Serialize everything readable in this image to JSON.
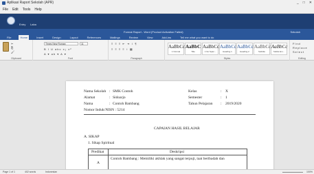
{
  "app": {
    "window_title": "Aplikasi Raport Sekolah (APR)",
    "controls": [
      "_",
      "□",
      "✕"
    ]
  },
  "menu": [
    "File",
    "Edit",
    "Tools",
    "Help"
  ],
  "task": {
    "labels": [
      "Entry",
      "Laba"
    ]
  },
  "ribbon": {
    "doc_title": "Format Raport - Word (Product Activation Failed)",
    "user": "Sekolah",
    "tabs": [
      "File",
      "Home",
      "Insert",
      "Design",
      "Layout",
      "References",
      "Mailings",
      "Review",
      "View",
      "Add-ins",
      "Tell me what you want to do"
    ],
    "active_tab": "Home",
    "groups": {
      "clipboard": "Clipboard",
      "font": "Font",
      "paragraph": "Paragraph",
      "styles": "Styles",
      "editing": "Editing"
    },
    "font_name": "Times New Roman",
    "font_size": "11",
    "styles": [
      {
        "sample": "AaBbCcI",
        "name": "1 Normal"
      },
      {
        "sample": "AaBbC",
        "name": "Title"
      },
      {
        "sample": "AaBbCcI",
        "name": "1 No Spac..."
      },
      {
        "sample": "AaBbCc",
        "name": "Heading 1"
      },
      {
        "sample": "AaBbCc",
        "name": "Heading 2"
      },
      {
        "sample": "AaBbCc",
        "name": "Subtitle"
      },
      {
        "sample": "AaBbCc",
        "name": "Subtle Em..."
      }
    ],
    "editing": [
      "Find",
      "Replace",
      "Select"
    ]
  },
  "document": {
    "nama_sekolah_label": "Nama Sekolah",
    "nama_sekolah_value": "SMK Contoh",
    "alamat_label": "Alamat",
    "alamat_value": "Sidoarjo",
    "nama_label": "Nama",
    "nama_value": "Contoh Bambang",
    "nomor_label": "Nomor Induk/NISN : 5214",
    "kelas_label": "Kelas",
    "kelas_value": "X",
    "semester_label": "Semester",
    "semester_value": "1",
    "tahun_label": "Tahun Pelajaran",
    "tahun_value": "2019/2020",
    "sep": ":",
    "heading": "CAPAIAN HASIL BELAJAR",
    "section_a": "A. SIKAP",
    "subsection_1": "1.  Sikap Spiritual",
    "table_col1": "Predikat",
    "table_col2": "Deskripsi",
    "table_row1_predikat": "A",
    "table_row1_desc": "Contoh Bambang : Memiliki akhlak yang sangat terpuji, taat beribadah dan"
  },
  "status": {
    "page": "Page 1 of 1",
    "words": "402 words",
    "lang": "Indonesian",
    "zoom": "100%"
  }
}
